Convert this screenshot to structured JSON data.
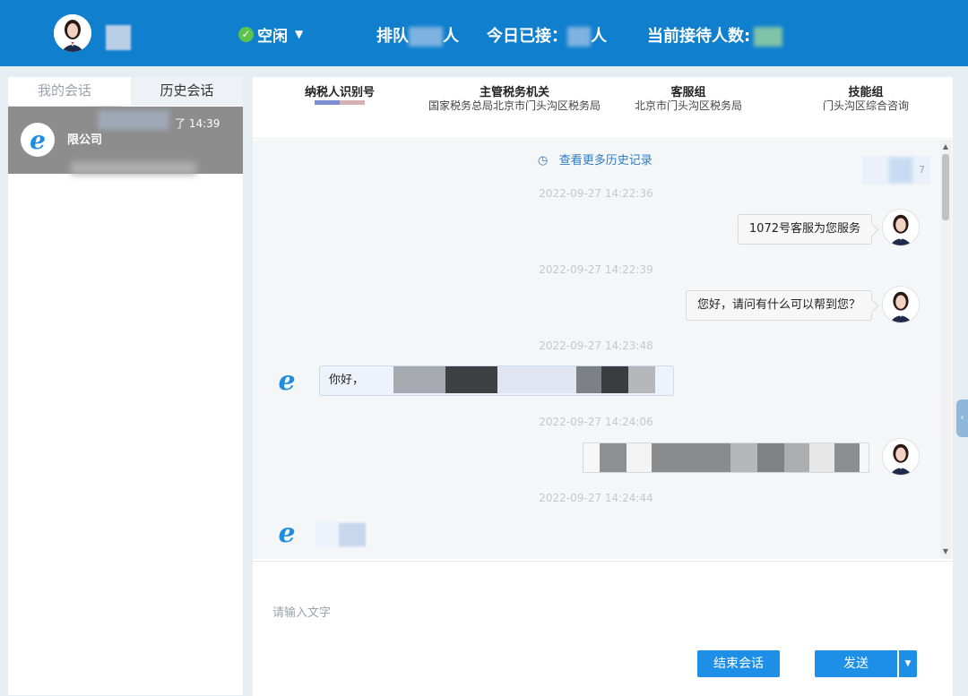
{
  "header": {
    "status_label": "空闲",
    "queue_label_prefix": "排队",
    "queue_label_suffix": "人",
    "today_label_prefix": "今日已接：",
    "today_label_suffix": "人",
    "waiting_label": "当前接待人数:"
  },
  "sidebar": {
    "tabs": [
      "我的会话",
      "历史会话"
    ],
    "session": {
      "name": "限公司",
      "time": "14:39",
      "time_prefix": "了"
    }
  },
  "info_bar": [
    {
      "label": "纳税人识别号",
      "value": ""
    },
    {
      "label": "主管税务机关",
      "value": "国家税务总局北京市门头沟区税务局"
    },
    {
      "label": "客服组",
      "value": "北京市门头沟区税务局"
    },
    {
      "label": "技能组",
      "value": "门头沟区综合咨询"
    }
  ],
  "chat": {
    "more_history": "查看更多历史记录",
    "timestamps": [
      "2022-09-27 14:22:36",
      "2022-09-27 14:22:39",
      "2022-09-27 14:23:48",
      "2022-09-27 14:24:06",
      "2022-09-27 14:24:44"
    ],
    "messages": [
      {
        "from": "agent",
        "text": "1072号客服为您服务"
      },
      {
        "from": "agent",
        "text": "您好，请问有什么可以帮到您？"
      },
      {
        "from": "user",
        "text": "你好，"
      }
    ],
    "top_badge": "7"
  },
  "input": {
    "placeholder": "请输入文字",
    "end_button": "结束会话",
    "send_button": "发送"
  }
}
